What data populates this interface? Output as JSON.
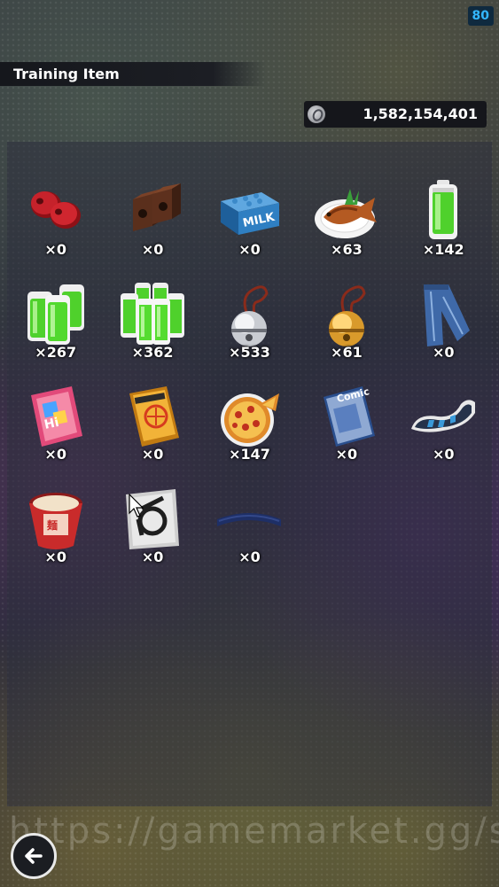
{
  "header": {
    "level": "80",
    "title": "Training Item"
  },
  "currency": {
    "icon": "coin-icon",
    "amount": "1,582,154,401"
  },
  "items": [
    {
      "name": "red-weights-icon",
      "qty": "×0"
    },
    {
      "name": "brick-weights-icon",
      "qty": "×0"
    },
    {
      "name": "milk-crate-icon",
      "qty": "×0"
    },
    {
      "name": "fish-dish-icon",
      "qty": "×63"
    },
    {
      "name": "battery-icon",
      "qty": "×142"
    },
    {
      "name": "battery-pack-icon",
      "qty": "×267"
    },
    {
      "name": "battery-bundle-icon",
      "qty": "×362"
    },
    {
      "name": "silver-bell-icon",
      "qty": "×533"
    },
    {
      "name": "gold-bell-icon",
      "qty": "×61"
    },
    {
      "name": "jeans-icon",
      "qty": "×0"
    },
    {
      "name": "pink-magazine-icon",
      "qty": "×0"
    },
    {
      "name": "orange-magazine-icon",
      "qty": "×0"
    },
    {
      "name": "pizza-icon",
      "qty": "×147"
    },
    {
      "name": "comic-book-icon",
      "qty": "×0"
    },
    {
      "name": "shoe-insole-icon",
      "qty": "×0"
    },
    {
      "name": "instant-noodle-cup-icon",
      "qty": "×0"
    },
    {
      "name": "sticker-card-icon",
      "qty": "×0"
    },
    {
      "name": "headband-icon",
      "qty": "×0"
    }
  ],
  "watermark": "https://gamemarket.gg/seller/",
  "footer": {
    "back_icon": "back-arrow-icon"
  },
  "colors": {
    "accent": "#33b6ff",
    "text": "#ffffff"
  }
}
